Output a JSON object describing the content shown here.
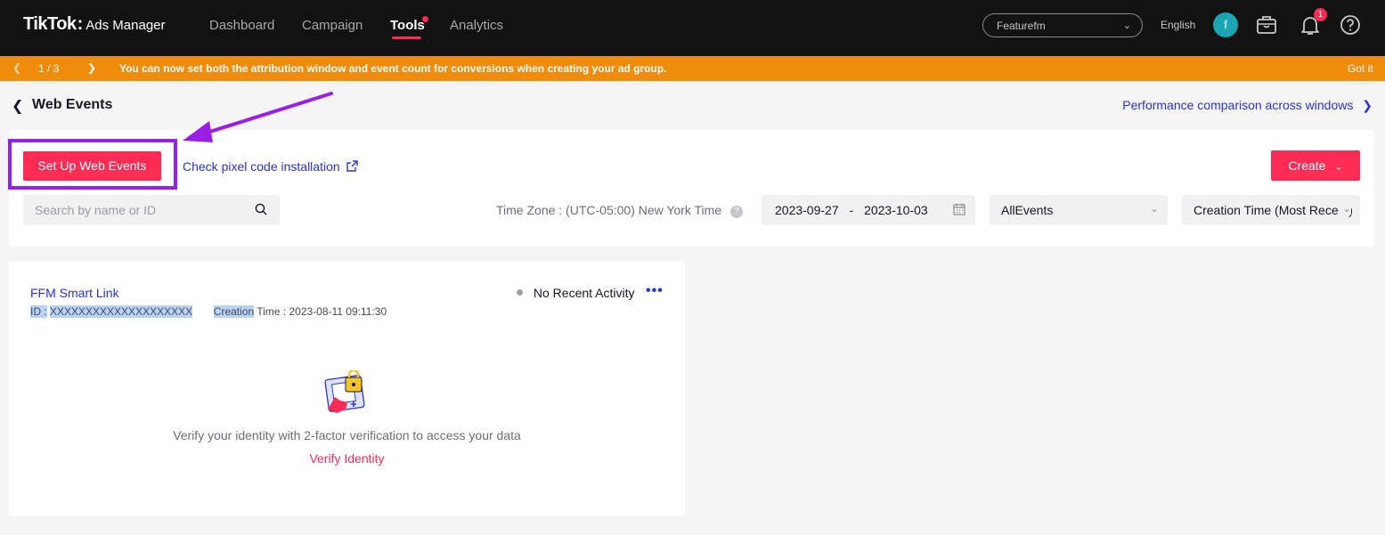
{
  "topbar": {
    "logo_brand": "TikTok",
    "logo_colon": ":",
    "logo_sub": "Ads Manager",
    "nav": [
      "Dashboard",
      "Campaign",
      "Tools",
      "Analytics"
    ],
    "active_nav": "Tools",
    "account": "Featurefm",
    "language": "English",
    "avatar_letter": "f",
    "notification_count": "1"
  },
  "banner": {
    "pager": "1  /  3",
    "message": "You can now set both the attribution window and event count for conversions when creating your ad group.",
    "dismiss": "Got it"
  },
  "header": {
    "title": "Web Events",
    "perf_link": "Performance comparison across windows"
  },
  "toolbar": {
    "setup_label": "Set Up Web Events",
    "pixel_link": "Check pixel code installation",
    "create_label": "Create",
    "search_placeholder": "Search by name or ID",
    "timezone": "Time Zone : (UTC-05:00) New York Time",
    "date_start": "2023-09-27",
    "date_sep": "-",
    "date_end": "2023-10-03",
    "event_filter": "AllEvents",
    "sort": "Creation Time (Most Recent)"
  },
  "pixel": {
    "name": "FFM Smart Link",
    "id_label": "ID :",
    "id_value": "XXXXXXXXXXXXXXXXXXXX",
    "creation_label_a": "Creation",
    "creation_label_b": " Time : 2023-08-11 09:11:30",
    "status": "No Recent Activity",
    "verify_message": "Verify your identity with 2-factor verification to access your data",
    "verify_link": "Verify Identity"
  },
  "colors": {
    "accent": "#fe2c55",
    "link": "#2b33c9",
    "banner": "#f08c0c",
    "annotation": "#9a1ee8"
  }
}
